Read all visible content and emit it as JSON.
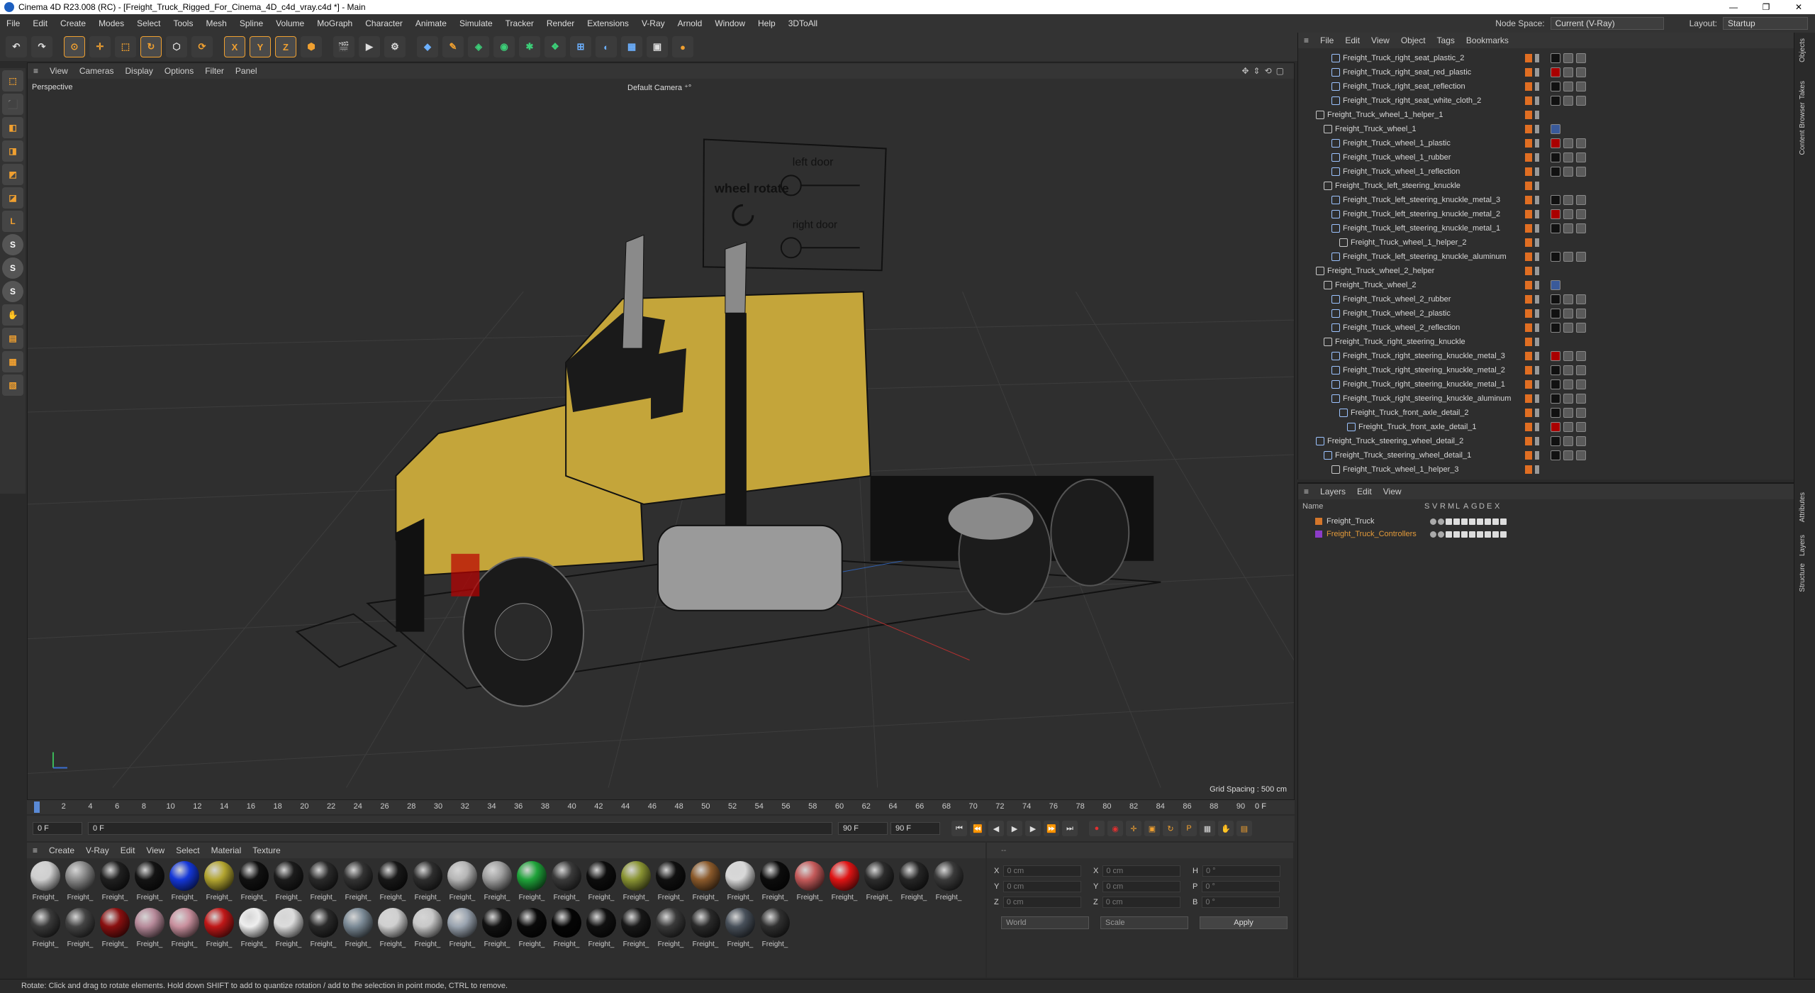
{
  "window": {
    "title": "Cinema 4D R23.008 (RC) - [Freight_Truck_Rigged_For_Cinema_4D_c4d_vray.c4d *] - Main",
    "min": "—",
    "max": "❐",
    "close": "✕"
  },
  "menu": {
    "items": [
      "File",
      "Edit",
      "Create",
      "Modes",
      "Select",
      "Tools",
      "Mesh",
      "Spline",
      "Volume",
      "MoGraph",
      "Character",
      "Animate",
      "Simulate",
      "Tracker",
      "Render",
      "Extensions",
      "V-Ray",
      "Arnold",
      "Window",
      "Help",
      "3DToAll"
    ],
    "node_space_label": "Node Space:",
    "node_space_value": "Current (V-Ray)",
    "layout_label": "Layout:",
    "layout_value": "Startup"
  },
  "toolbar": {
    "buttons": [
      "↶",
      "↷",
      "⊙",
      "✛",
      "⬚",
      "↻",
      "⬡",
      "⟳",
      "X",
      "Y",
      "Z",
      "⬢",
      "🎬",
      "▶",
      "⚙",
      "◆",
      "✎",
      "◈",
      "◉",
      "✱",
      "❖",
      "⊞",
      "◐",
      "▦",
      "▣",
      "●"
    ]
  },
  "lefttools": [
    "⬚",
    "⬛",
    "◧",
    "◨",
    "◩",
    "◪",
    "L",
    "S",
    "S",
    "S",
    "✋",
    "▤",
    "▦",
    "▧"
  ],
  "viewport": {
    "menu": [
      "View",
      "Cameras",
      "Display",
      "Options",
      "Filter",
      "Panel"
    ],
    "label": "Perspective",
    "camera": "Default Camera ⁺°",
    "grid_spacing": "Grid Spacing : 500 cm",
    "sign_left": "left door",
    "sign_wheel": "wheel rotate",
    "sign_right": "right door"
  },
  "timeline": {
    "ticks": [
      "0",
      "2",
      "4",
      "6",
      "8",
      "10",
      "12",
      "14",
      "16",
      "18",
      "20",
      "22",
      "24",
      "26",
      "28",
      "30",
      "32",
      "34",
      "36",
      "38",
      "40",
      "42",
      "44",
      "46",
      "48",
      "50",
      "52",
      "54",
      "56",
      "58",
      "60",
      "62",
      "64",
      "66",
      "68",
      "70",
      "72",
      "74",
      "76",
      "78",
      "80",
      "82",
      "84",
      "86",
      "88",
      "90"
    ],
    "current": "0 F"
  },
  "transport": {
    "start": "0 F",
    "current": "0 F",
    "end": "90 F",
    "end2": "90 F"
  },
  "materials": {
    "menu": [
      "Create",
      "V-Ray",
      "Edit",
      "View",
      "Select",
      "Material",
      "Texture"
    ],
    "label": "Freight_",
    "row1": [
      "#cfcfcf",
      "#8a8a8a",
      "#202020",
      "#141414",
      "#1437d8",
      "#b3a530",
      "#111111",
      "#1c1c1c",
      "#2a2a2a",
      "#333333",
      "#181818",
      "#2e2e2e",
      "#b5b5b5",
      "#a0a0a0",
      "#1fa33a",
      "#3a3a3a",
      "#0d0d0d",
      "#8a9433",
      "#101010",
      "#8b5a2b",
      "#d8d8d8",
      "#0c0c0c",
      "#c45a5a",
      "#e01414",
      "#2c2c2c",
      "#262626",
      "#3a3a3a"
    ],
    "row2": [
      "#3a3a3a",
      "#444444",
      "#8a1010",
      "#b78a9a",
      "#c9909e",
      "#c01818",
      "#eeeeee",
      "#dcdcdc",
      "#2a2a2a",
      "#7b8a96",
      "#d0d0d0",
      "#c8c8c8",
      "#9aa4b0",
      "#111111",
      "#0a0a0a",
      "#050505",
      "#101010",
      "#181818",
      "#3a3a3a",
      "#2a2a2a",
      "#48505a",
      "#303030"
    ]
  },
  "attributes": {
    "x": "X",
    "y": "Y",
    "z": "Z",
    "h": "H",
    "p": "P",
    "b": "B",
    "val_cm": "0 cm",
    "val_deg": "0 °",
    "coord": "World",
    "mode": "Scale",
    "apply": "Apply",
    "top": "--"
  },
  "objects": {
    "menu": [
      "File",
      "Edit",
      "View",
      "Object",
      "Tags",
      "Bookmarks"
    ],
    "rows": [
      {
        "name": "Freight_Truck_right_seat_plastic_2",
        "indent": 3,
        "null": false
      },
      {
        "name": "Freight_Truck_right_seat_red_plastic",
        "indent": 3,
        "null": false
      },
      {
        "name": "Freight_Truck_right_seat_reflection",
        "indent": 3,
        "null": false
      },
      {
        "name": "Freight_Truck_right_seat_white_cloth_2",
        "indent": 3,
        "null": false
      },
      {
        "name": "Freight_Truck_wheel_1_helper_1",
        "indent": 1,
        "null": true
      },
      {
        "name": "Freight_Truck_wheel_1",
        "indent": 2,
        "null": true
      },
      {
        "name": "Freight_Truck_wheel_1_plastic",
        "indent": 3,
        "null": false
      },
      {
        "name": "Freight_Truck_wheel_1_rubber",
        "indent": 3,
        "null": false
      },
      {
        "name": "Freight_Truck_wheel_1_reflection",
        "indent": 3,
        "null": false
      },
      {
        "name": "Freight_Truck_left_steering_knuckle",
        "indent": 2,
        "null": true
      },
      {
        "name": "Freight_Truck_left_steering_knuckle_metal_3",
        "indent": 3,
        "null": false
      },
      {
        "name": "Freight_Truck_left_steering_knuckle_metal_2",
        "indent": 3,
        "null": false
      },
      {
        "name": "Freight_Truck_left_steering_knuckle_metal_1",
        "indent": 3,
        "null": false
      },
      {
        "name": "Freight_Truck_wheel_1_helper_2",
        "indent": 4,
        "null": true
      },
      {
        "name": "Freight_Truck_left_steering_knuckle_aluminum",
        "indent": 3,
        "null": false
      },
      {
        "name": "Freight_Truck_wheel_2_helper",
        "indent": 1,
        "null": true
      },
      {
        "name": "Freight_Truck_wheel_2",
        "indent": 2,
        "null": true
      },
      {
        "name": "Freight_Truck_wheel_2_rubber",
        "indent": 3,
        "null": false
      },
      {
        "name": "Freight_Truck_wheel_2_plastic",
        "indent": 3,
        "null": false
      },
      {
        "name": "Freight_Truck_wheel_2_reflection",
        "indent": 3,
        "null": false
      },
      {
        "name": "Freight_Truck_right_steering_knuckle",
        "indent": 2,
        "null": true
      },
      {
        "name": "Freight_Truck_right_steering_knuckle_metal_3",
        "indent": 3,
        "null": false
      },
      {
        "name": "Freight_Truck_right_steering_knuckle_metal_2",
        "indent": 3,
        "null": false
      },
      {
        "name": "Freight_Truck_right_steering_knuckle_metal_1",
        "indent": 3,
        "null": false
      },
      {
        "name": "Freight_Truck_right_steering_knuckle_aluminum",
        "indent": 3,
        "null": false
      },
      {
        "name": "Freight_Truck_front_axle_detail_2",
        "indent": 4,
        "null": false
      },
      {
        "name": "Freight_Truck_front_axle_detail_1",
        "indent": 5,
        "null": false
      },
      {
        "name": "Freight_Truck_steering_wheel_detail_2",
        "indent": 1,
        "null": false
      },
      {
        "name": "Freight_Truck_steering_wheel_detail_1",
        "indent": 2,
        "null": false
      },
      {
        "name": "Freight_Truck_wheel_1_helper_3",
        "indent": 3,
        "null": true
      }
    ]
  },
  "layers": {
    "menu": [
      "Layers",
      "Edit",
      "View"
    ],
    "header_name": "Name",
    "header_cols": [
      "S",
      "V",
      "R",
      "M",
      "L",
      "A",
      "G",
      "D",
      "E",
      "X"
    ],
    "rows": [
      {
        "name": "Freight_Truck",
        "color": "#d4762a",
        "sel": false
      },
      {
        "name": "Freight_Truck_Controllers",
        "color": "#8c3cc8",
        "sel": true
      }
    ]
  },
  "righttabs": [
    "Objects",
    "Takes",
    "Content Browser",
    "Attributes",
    "Layers",
    "Structure"
  ],
  "status": "Rotate: Click and drag to rotate elements. Hold down SHIFT to add to quantize rotation / add to the selection in point mode, CTRL to remove."
}
